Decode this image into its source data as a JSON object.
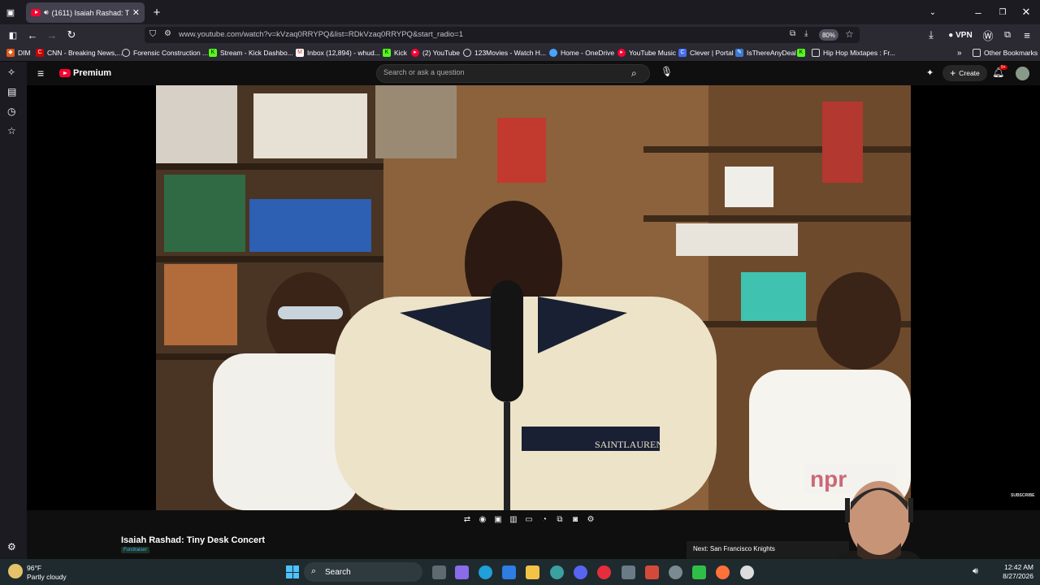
{
  "browser": {
    "tab_title": "(1611) Isaiah Rashad: Tiny D",
    "url": "www.youtube.com/watch?v=kVzaq0RRYPQ&list=RDkVzaq0RRYPQ&start_radio=1",
    "zoom": "80%",
    "vpn_label": "VPN"
  },
  "bookmarks": [
    {
      "label": "DIM"
    },
    {
      "label": "CNN - Breaking News,..."
    },
    {
      "label": "Forensic Construction ..."
    },
    {
      "label": "Stream - Kick Dashbo..."
    },
    {
      "label": "Inbox (12,894) - whud..."
    },
    {
      "label": "Kick"
    },
    {
      "label": "(2) YouTube"
    },
    {
      "label": "123Movies - Watch H..."
    },
    {
      "label": "Home - OneDrive"
    },
    {
      "label": "YouTube Music"
    },
    {
      "label": "Clever | Portal"
    },
    {
      "label": "IsThereAnyDeal"
    },
    {
      "label": "Hip Hop Mixtapes : Fr..."
    }
  ],
  "other_bookmarks": "Other Bookmarks",
  "youtube": {
    "logo": "Premium",
    "search_placeholder": "Search or ask a question",
    "create_label": "Create",
    "notif_count": "9+",
    "subscribe_watermark": "SUBSCRIBE",
    "npr_watermark": "npr",
    "video_title": "Isaiah Rashad: Tiny Desk Concert",
    "fundraiser_badge": "Fundraiser",
    "next_label": "Next: San Francisco Knights"
  },
  "taskbar": {
    "temp": "96°F",
    "condition": "Partly cloudy",
    "search_label": "Search",
    "time": "12:42 AM",
    "date": "8/27/2026"
  }
}
